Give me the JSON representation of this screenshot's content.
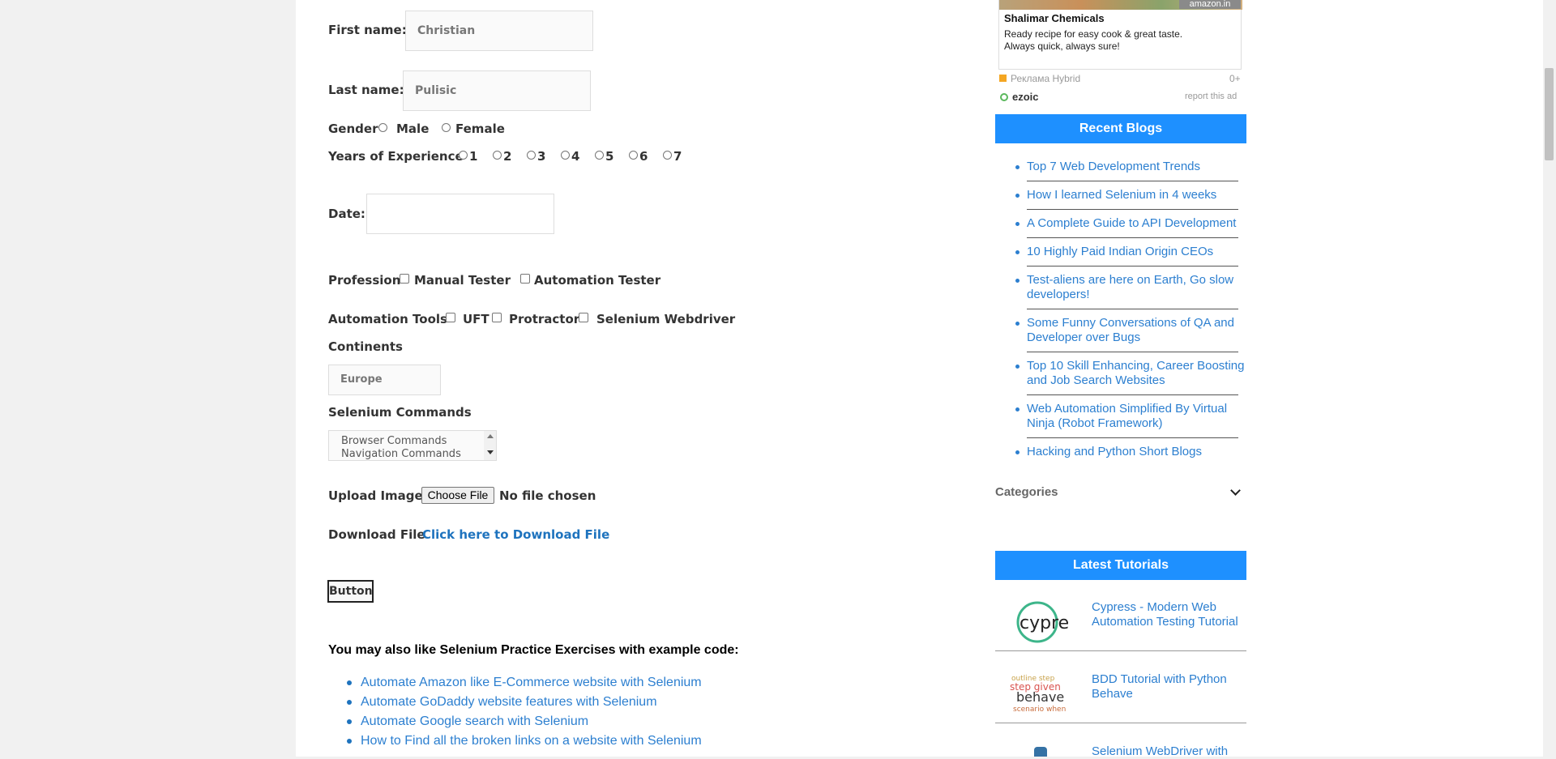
{
  "form": {
    "first_name_label": "First name:",
    "first_name_value": "Christian",
    "last_name_label": "Last name:",
    "last_name_value": "Pulisic",
    "gender_label": "Gender",
    "gender_options": [
      "Male",
      "Female"
    ],
    "experience_label": "Years of Experience",
    "experience_options": [
      "1",
      "2",
      "3",
      "4",
      "5",
      "6",
      "7"
    ],
    "date_label": "Date:",
    "date_value": "",
    "profession_label": "Profession",
    "profession_options": [
      "Manual Tester",
      "Automation Tester"
    ],
    "tools_label": "Automation Tools",
    "tools_options": [
      "UFT",
      "Protractor",
      "Selenium Webdriver"
    ],
    "continents_label": "Continents",
    "continents_value": "Europe",
    "commands_label": "Selenium Commands",
    "commands_options": [
      "Browser Commands",
      "Navigation Commands"
    ],
    "upload_label": "Upload Image",
    "upload_button": "Choose File",
    "upload_status": "No file chosen",
    "download_label": "Download File",
    "download_link": "Click here to Download File",
    "button_label": "Button"
  },
  "also_like": {
    "heading": "You may also like Selenium Practice Exercises with example code:",
    "items": [
      "Automate Amazon like E-Commerce website with Selenium",
      "Automate GoDaddy website features with Selenium",
      "Automate Google search with Selenium",
      "How to Find all the broken links on a website with Selenium"
    ]
  },
  "ad": {
    "brand": "amazon.in",
    "title": "Shalimar Chemicals",
    "text_line1": "Ready recipe for easy cook & great taste.",
    "text_line2": "Always quick, always sure!",
    "network": "Реклама Hybrid",
    "age": "0+",
    "ezoic": "ezoic",
    "report": "report this ad"
  },
  "recent_blogs": {
    "title": "Recent Blogs",
    "items": [
      "Top 7 Web Development Trends",
      "How I learned Selenium in 4 weeks",
      "A Complete Guide to API Development",
      "10 Highly Paid Indian Origin CEOs",
      "Test-aliens are here on Earth, Go slow developers!",
      "Some Funny Conversations of QA and Developer over Bugs",
      "Top 10 Skill Enhancing, Career Boosting and Job Search Websites",
      "Web Automation Simplified By Virtual Ninja (Robot Framework)",
      "Hacking and Python Short Blogs"
    ]
  },
  "categories": {
    "label": "Categories"
  },
  "latest_tutorials": {
    "title": "Latest Tutorials",
    "items": [
      {
        "logo": "cypress",
        "label": "Cypress - Modern Web Automation Testing Tutorial"
      },
      {
        "logo": "behave",
        "label": "BDD Tutorial with Python Behave"
      },
      {
        "logo": "python",
        "label": "Selenium WebDriver with"
      }
    ]
  },
  "colors": {
    "accent": "#1e90ff",
    "link": "#2c7fd0"
  }
}
